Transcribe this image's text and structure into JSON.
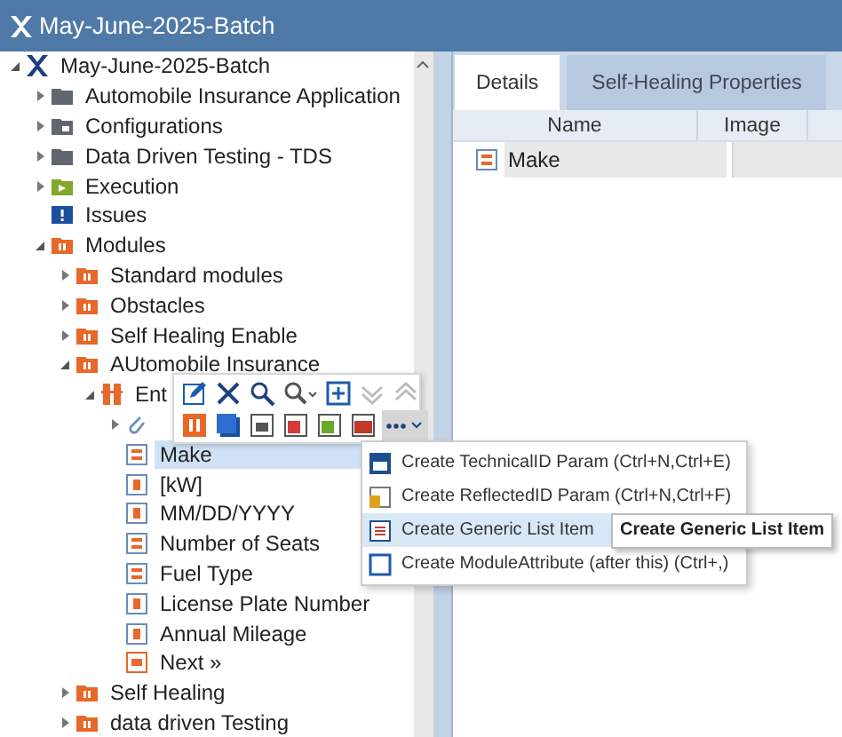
{
  "window": {
    "title": "May-June-2025-Batch"
  },
  "tree": [
    {
      "label": "May-June-2025-Batch",
      "kind": "project",
      "expanded": true,
      "selected": false,
      "children": [
        {
          "label": "Automobile Insurance Application",
          "kind": "folder",
          "expanded": false,
          "selected": false
        },
        {
          "label": "Configurations",
          "kind": "config",
          "expanded": false,
          "selected": false
        },
        {
          "label": "Data Driven Testing - TDS",
          "kind": "folder",
          "expanded": false,
          "selected": false
        },
        {
          "label": "Execution",
          "kind": "execution",
          "expanded": false,
          "selected": false
        },
        {
          "label": "Issues",
          "kind": "issues",
          "selected": false
        },
        {
          "label": "Modules",
          "kind": "module-folder",
          "expanded": true,
          "selected": false,
          "children": [
            {
              "label": "Standard modules",
              "kind": "module-folder",
              "expanded": false,
              "selected": false
            },
            {
              "label": "Obstacles",
              "kind": "module-folder",
              "expanded": false,
              "selected": false
            },
            {
              "label": "Self Healing Enable",
              "kind": "module-folder",
              "expanded": false,
              "selected": false
            },
            {
              "label": "AUtomobile Insurance",
              "kind": "module-folder",
              "expanded": true,
              "selected": false,
              "children": [
                {
                  "label": "Ent",
                  "kind": "module",
                  "expanded": true,
                  "selected": false,
                  "children": [
                    {
                      "kind": "attachment",
                      "expanded": false
                    },
                    {
                      "label": "Make",
                      "kind": "list",
                      "selected": true
                    },
                    {
                      "label": "[kW]",
                      "kind": "input",
                      "selected": false
                    },
                    {
                      "label": "MM/DD/YYYY",
                      "kind": "input",
                      "selected": false
                    },
                    {
                      "label": "Number of Seats",
                      "kind": "list",
                      "selected": false
                    },
                    {
                      "label": "Fuel Type",
                      "kind": "list",
                      "selected": false
                    },
                    {
                      "label": "License Plate Number",
                      "kind": "input",
                      "selected": false
                    },
                    {
                      "label": "Annual Mileage",
                      "kind": "input",
                      "selected": false
                    },
                    {
                      "label": "Next »",
                      "kind": "button",
                      "selected": false
                    }
                  ]
                }
              ]
            },
            {
              "label": "Self Healing",
              "kind": "module-folder",
              "expanded": false,
              "selected": false
            },
            {
              "label": "data driven Testing",
              "kind": "module-folder",
              "expanded": false,
              "selected": false
            }
          ]
        }
      ]
    }
  ],
  "toolbar": {
    "more_open": true
  },
  "menu": [
    {
      "label": "Create TechnicalID Param (Ctrl+N,Ctrl+E)",
      "kind": "technical",
      "selected": false
    },
    {
      "label": "Create ReflectedID Param (Ctrl+N,Ctrl+F)",
      "kind": "reflected",
      "selected": false
    },
    {
      "label": "Create Generic List Item",
      "kind": "list",
      "selected": true
    },
    {
      "label": "Create ModuleAttribute (after this) (Ctrl+,)",
      "kind": "attribute",
      "selected": false
    }
  ],
  "tooltip": "Create Generic List Item",
  "tabs": [
    {
      "label": "Details",
      "selected": true
    },
    {
      "label": "Self-Healing Properties",
      "selected": false
    }
  ],
  "table": {
    "columns": [
      "Name",
      "Image"
    ],
    "rows": [
      {
        "name": "Make",
        "kind": "list"
      }
    ]
  }
}
